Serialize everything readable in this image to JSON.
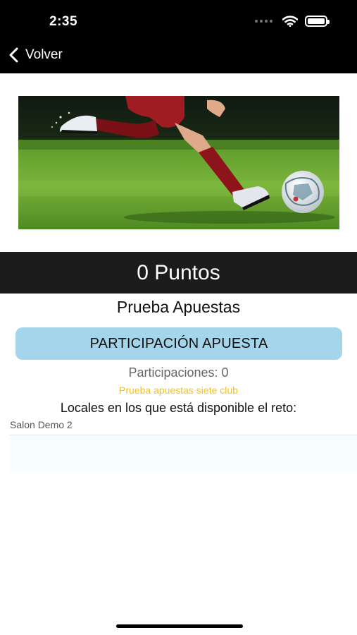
{
  "status_bar": {
    "time": "2:35"
  },
  "nav": {
    "back_label": "Volver"
  },
  "points": {
    "label": "0 Puntos"
  },
  "challenge": {
    "title": "Prueba Apuestas"
  },
  "actions": {
    "participate_label": "PARTICIPACIÓN APUESTA"
  },
  "stats": {
    "participations": "Participaciones: 0"
  },
  "club": {
    "label": "Prueba apuestas siete club"
  },
  "venues": {
    "heading": "Locales en los que está disponible el reto:",
    "items": [
      {
        "name": "Salon Demo 2"
      }
    ]
  },
  "colors": {
    "accent_button": "#a4d5eb",
    "club_text": "#f2c21b",
    "points_bar": "#1c1c1c"
  }
}
